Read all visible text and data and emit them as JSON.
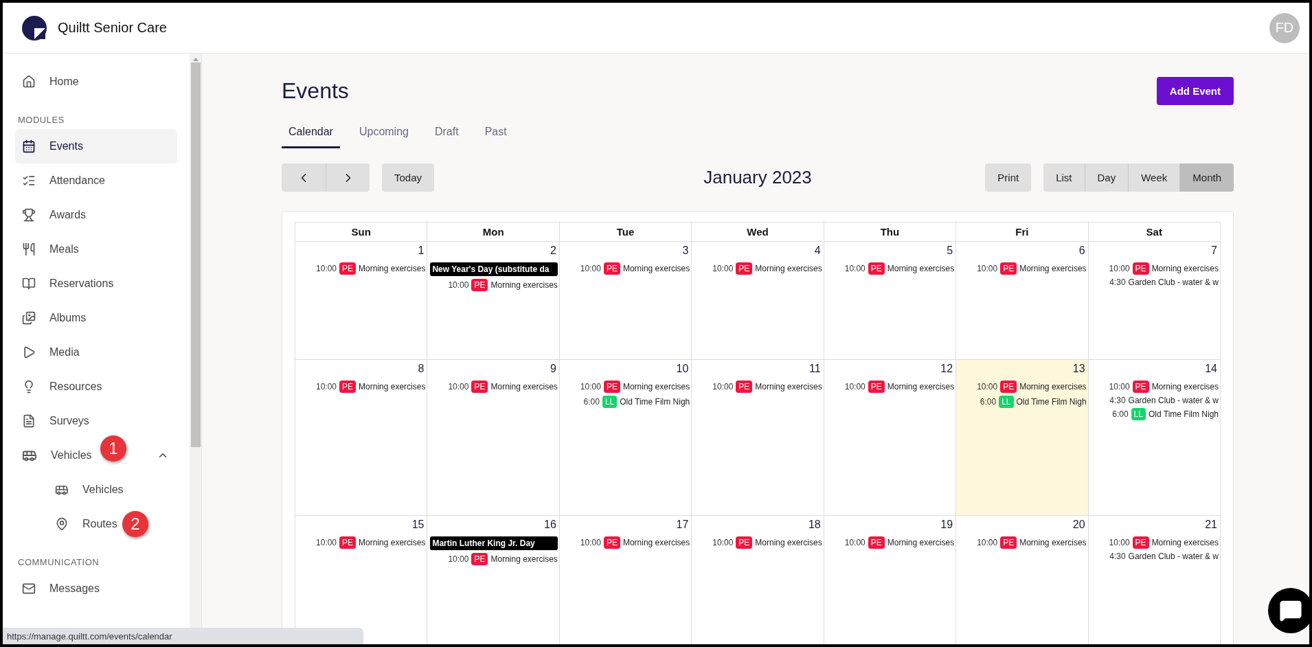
{
  "app": {
    "name": "Quiltt Senior Care",
    "avatar": "FD"
  },
  "sidebar": [
    {
      "kind": "item",
      "label": "Home",
      "selected": false
    },
    {
      "kind": "heading",
      "label": "MODULES"
    },
    {
      "kind": "item",
      "label": "Events",
      "selected": true
    },
    {
      "kind": "item",
      "label": "Attendance",
      "selected": false
    },
    {
      "kind": "item",
      "label": "Awards",
      "selected": false
    },
    {
      "kind": "item",
      "label": "Meals",
      "selected": false
    },
    {
      "kind": "item",
      "label": "Reservations",
      "selected": false
    },
    {
      "kind": "item",
      "label": "Albums",
      "selected": false
    },
    {
      "kind": "item",
      "label": "Media",
      "selected": false
    },
    {
      "kind": "item",
      "label": "Resources",
      "selected": false
    },
    {
      "kind": "item",
      "label": "Surveys",
      "selected": false
    },
    {
      "kind": "group",
      "label": "Vehicles",
      "expanded": true,
      "marker": "1",
      "children": [
        {
          "label": "Vehicles",
          "selected": false
        },
        {
          "label": "Routes",
          "selected": false,
          "marker": "2"
        }
      ]
    },
    {
      "kind": "heading",
      "label": "COMMUNICATION"
    },
    {
      "kind": "item",
      "label": "Messages",
      "selected": false
    }
  ],
  "page": {
    "title": "Events",
    "add_button": "Add Event"
  },
  "tabs": [
    {
      "label": "Calendar",
      "selected": true
    },
    {
      "label": "Upcoming",
      "selected": false
    },
    {
      "label": "Draft",
      "selected": false
    },
    {
      "label": "Past",
      "selected": false
    }
  ],
  "toolbar": {
    "today": "Today",
    "month_title": "January 2023",
    "print": "Print",
    "views": [
      {
        "label": "List",
        "selected": false
      },
      {
        "label": "Day",
        "selected": false
      },
      {
        "label": "Week",
        "selected": false
      },
      {
        "label": "Month",
        "selected": true
      }
    ]
  },
  "calendar": {
    "weekdays": [
      "Sun",
      "Mon",
      "Tue",
      "Wed",
      "Thu",
      "Fri",
      "Sat"
    ],
    "weeks": [
      {
        "days": [
          {
            "date": "1",
            "today": false,
            "events": [
              {
                "kind": "timed",
                "time": "10:00",
                "badge": {
                  "label": "PE",
                  "color": "#f0163f"
                },
                "title": "Morning exercises"
              }
            ]
          },
          {
            "date": "2",
            "today": false,
            "events": [
              {
                "kind": "allday",
                "title": "New Year's Day (substitute da"
              },
              {
                "kind": "timed",
                "time": "10:00",
                "badge": {
                  "label": "PE",
                  "color": "#f0163f"
                },
                "title": "Morning exercises"
              }
            ]
          },
          {
            "date": "3",
            "today": false,
            "events": [
              {
                "kind": "timed",
                "time": "10:00",
                "badge": {
                  "label": "PE",
                  "color": "#f0163f"
                },
                "title": "Morning exercises"
              }
            ]
          },
          {
            "date": "4",
            "today": false,
            "events": [
              {
                "kind": "timed",
                "time": "10:00",
                "badge": {
                  "label": "PE",
                  "color": "#f0163f"
                },
                "title": "Morning exercises"
              }
            ]
          },
          {
            "date": "5",
            "today": false,
            "events": [
              {
                "kind": "timed",
                "time": "10:00",
                "badge": {
                  "label": "PE",
                  "color": "#f0163f"
                },
                "title": "Morning exercises"
              }
            ]
          },
          {
            "date": "6",
            "today": false,
            "events": [
              {
                "kind": "timed",
                "time": "10:00",
                "badge": {
                  "label": "PE",
                  "color": "#f0163f"
                },
                "title": "Morning exercises"
              }
            ]
          },
          {
            "date": "7",
            "today": false,
            "events": [
              {
                "kind": "timed",
                "time": "10:00",
                "badge": {
                  "label": "PE",
                  "color": "#f0163f"
                },
                "title": "Morning exercises"
              },
              {
                "kind": "timed",
                "time": "4:30",
                "title": "Garden Club - water & w"
              }
            ]
          }
        ]
      },
      {
        "days": [
          {
            "date": "8",
            "today": false,
            "events": [
              {
                "kind": "timed",
                "time": "10:00",
                "badge": {
                  "label": "PE",
                  "color": "#f0163f"
                },
                "title": "Morning exercises"
              }
            ]
          },
          {
            "date": "9",
            "today": false,
            "events": [
              {
                "kind": "timed",
                "time": "10:00",
                "badge": {
                  "label": "PE",
                  "color": "#f0163f"
                },
                "title": "Morning exercises"
              }
            ]
          },
          {
            "date": "10",
            "today": false,
            "events": [
              {
                "kind": "timed",
                "time": "10:00",
                "badge": {
                  "label": "PE",
                  "color": "#f0163f"
                },
                "title": "Morning exercises"
              },
              {
                "kind": "timed",
                "time": "6:00",
                "badge": {
                  "label": "LL",
                  "color": "#14d66b"
                },
                "title": "Old Time Film Nigh"
              }
            ]
          },
          {
            "date": "11",
            "today": false,
            "events": [
              {
                "kind": "timed",
                "time": "10:00",
                "badge": {
                  "label": "PE",
                  "color": "#f0163f"
                },
                "title": "Morning exercises"
              }
            ]
          },
          {
            "date": "12",
            "today": false,
            "events": [
              {
                "kind": "timed",
                "time": "10:00",
                "badge": {
                  "label": "PE",
                  "color": "#f0163f"
                },
                "title": "Morning exercises"
              }
            ]
          },
          {
            "date": "13",
            "today": true,
            "events": [
              {
                "kind": "timed",
                "time": "10:00",
                "badge": {
                  "label": "PE",
                  "color": "#f0163f"
                },
                "title": "Morning exercises"
              },
              {
                "kind": "timed",
                "time": "6:00",
                "badge": {
                  "label": "LL",
                  "color": "#14d66b"
                },
                "title": "Old Time Film Nigh"
              }
            ]
          },
          {
            "date": "14",
            "today": false,
            "events": [
              {
                "kind": "timed",
                "time": "10:00",
                "badge": {
                  "label": "PE",
                  "color": "#f0163f"
                },
                "title": "Morning exercises"
              },
              {
                "kind": "timed",
                "time": "4:30",
                "title": "Garden Club - water & w"
              },
              {
                "kind": "timed",
                "time": "6:00",
                "badge": {
                  "label": "LL",
                  "color": "#14d66b"
                },
                "title": "Old Time Film Nigh"
              }
            ]
          }
        ]
      },
      {
        "days": [
          {
            "date": "15",
            "today": false,
            "events": [
              {
                "kind": "timed",
                "time": "10:00",
                "badge": {
                  "label": "PE",
                  "color": "#f0163f"
                },
                "title": "Morning exercises"
              }
            ]
          },
          {
            "date": "16",
            "today": false,
            "events": [
              {
                "kind": "allday",
                "title": "Martin Luther King Jr. Day"
              },
              {
                "kind": "timed",
                "time": "10:00",
                "badge": {
                  "label": "PE",
                  "color": "#f0163f"
                },
                "title": "Morning exercises"
              }
            ]
          },
          {
            "date": "17",
            "today": false,
            "events": [
              {
                "kind": "timed",
                "time": "10:00",
                "badge": {
                  "label": "PE",
                  "color": "#f0163f"
                },
                "title": "Morning exercises"
              }
            ]
          },
          {
            "date": "18",
            "today": false,
            "events": [
              {
                "kind": "timed",
                "time": "10:00",
                "badge": {
                  "label": "PE",
                  "color": "#f0163f"
                },
                "title": "Morning exercises"
              }
            ]
          },
          {
            "date": "19",
            "today": false,
            "events": [
              {
                "kind": "timed",
                "time": "10:00",
                "badge": {
                  "label": "PE",
                  "color": "#f0163f"
                },
                "title": "Morning exercises"
              }
            ]
          },
          {
            "date": "20",
            "today": false,
            "events": [
              {
                "kind": "timed",
                "time": "10:00",
                "badge": {
                  "label": "PE",
                  "color": "#f0163f"
                },
                "title": "Morning exercises"
              }
            ]
          },
          {
            "date": "21",
            "today": false,
            "events": [
              {
                "kind": "timed",
                "time": "10:00",
                "badge": {
                  "label": "PE",
                  "color": "#f0163f"
                },
                "title": "Morning exercises"
              },
              {
                "kind": "timed",
                "time": "4:30",
                "title": "Garden Club - water & w"
              }
            ]
          }
        ]
      }
    ]
  },
  "status_bar": {
    "url": "https://manage.quiltt.com/events/calendar"
  }
}
